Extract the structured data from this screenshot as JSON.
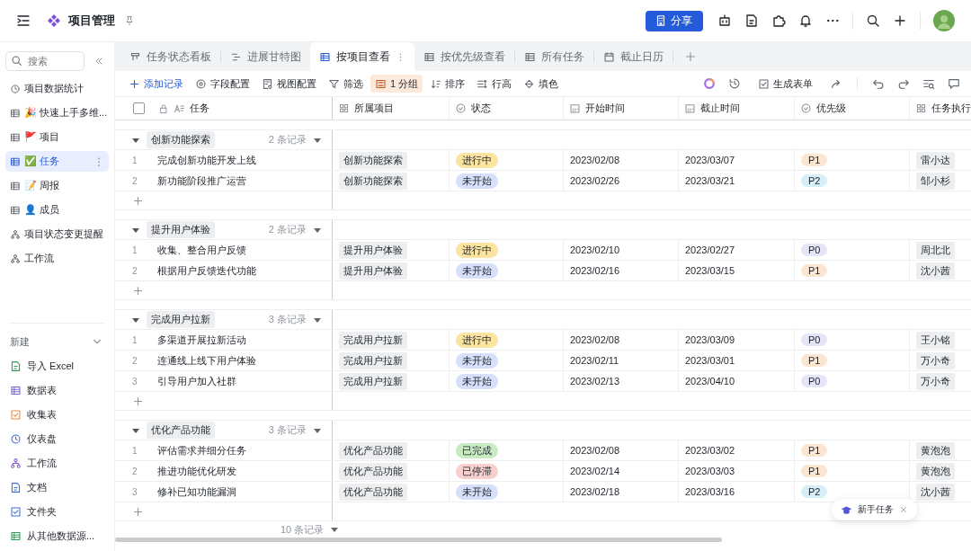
{
  "header": {
    "title": "项目管理",
    "share_button": "分享"
  },
  "sidebar": {
    "search": {
      "placeholder": "搜索"
    },
    "items": [
      {
        "label": "项目数据统计",
        "kind": "dashboard",
        "selected": false
      },
      {
        "label": "🎉 快速上手多维...",
        "kind": "table",
        "selected": false
      },
      {
        "label": "🚩 项目",
        "kind": "table",
        "selected": false
      },
      {
        "label": "✅ 任务",
        "kind": "table",
        "selected": true
      },
      {
        "label": "📝 周报",
        "kind": "table",
        "selected": false
      },
      {
        "label": "👤 成员",
        "kind": "table",
        "selected": false
      },
      {
        "label": "项目状态变更提醒",
        "kind": "workflow",
        "selected": false
      },
      {
        "label": "工作流",
        "kind": "workflow",
        "selected": false
      }
    ],
    "new_section": {
      "label": "新建",
      "items": [
        {
          "label": "导入 Excel",
          "kind": "excel"
        },
        {
          "label": "数据表",
          "kind": "datatable"
        },
        {
          "label": "收集表",
          "kind": "form"
        },
        {
          "label": "仪表盘",
          "kind": "dashboard"
        },
        {
          "label": "工作流",
          "kind": "workflow"
        },
        {
          "label": "文档",
          "kind": "doc"
        },
        {
          "label": "文件夹",
          "kind": "folder"
        },
        {
          "label": "从其他数据源...",
          "kind": "source"
        }
      ]
    }
  },
  "tabs": [
    {
      "label": "任务状态看板",
      "kind": "kanban",
      "selected": false
    },
    {
      "label": "进展甘特图",
      "kind": "gantt",
      "selected": false
    },
    {
      "label": "按项目查看",
      "kind": "grid",
      "selected": true
    },
    {
      "label": "按优先级查看",
      "kind": "grid",
      "selected": false
    },
    {
      "label": "所有任务",
      "kind": "grid",
      "selected": false
    },
    {
      "label": "截止日历",
      "kind": "calendar",
      "selected": false
    }
  ],
  "toolbar": {
    "left": [
      {
        "label": "添加记录",
        "kind": "add",
        "active": false
      },
      {
        "label": "字段配置",
        "kind": "gear",
        "active": false
      },
      {
        "label": "视图配置",
        "kind": "view",
        "active": false
      },
      {
        "label": "筛选",
        "kind": "filter",
        "active": false
      },
      {
        "label": "1 分组",
        "kind": "group",
        "active": true
      },
      {
        "label": "排序",
        "kind": "sort",
        "active": false
      },
      {
        "label": "行高",
        "kind": "rowheight",
        "active": false
      },
      {
        "label": "填色",
        "kind": "fill",
        "active": false
      }
    ],
    "right": [
      {
        "kind": "ai"
      },
      {
        "kind": "history"
      },
      {
        "kind": "form",
        "label": "生成表单"
      },
      {
        "kind": "shareout"
      },
      {
        "kind": "undo"
      },
      {
        "kind": "redo"
      },
      {
        "kind": "findlist"
      },
      {
        "kind": "comment"
      }
    ]
  },
  "table": {
    "select_all": {
      "checked": false
    },
    "columns": [
      {
        "label": "任务",
        "kind": "text"
      },
      {
        "label": "所属项目",
        "kind": "link"
      },
      {
        "label": "状态",
        "kind": "status"
      },
      {
        "label": "开始时间",
        "kind": "date"
      },
      {
        "label": "截止时间",
        "kind": "date"
      },
      {
        "label": "优先级",
        "kind": "status"
      },
      {
        "label": "任务执行",
        "kind": "link"
      }
    ],
    "groups": [
      {
        "name": "创新功能探索",
        "count": "2 条记录",
        "rows": [
          {
            "index": "1",
            "task": "完成创新功能开发上线",
            "project": "创新功能探索",
            "status": {
              "text": "进行中",
              "color": "#fbe3a0"
            },
            "start": "2023/02/08",
            "end": "2023/03/07",
            "priority": {
              "text": "P1",
              "color": "#fbe6d2"
            },
            "assignee": "雷小达"
          },
          {
            "index": "2",
            "task": "新功能阶段推广运营",
            "project": "创新功能探索",
            "status": {
              "text": "未开始",
              "color": "#d7e0fa"
            },
            "start": "2023/02/26",
            "end": "2023/03/21",
            "priority": {
              "text": "P2",
              "color": "#d6eff8"
            },
            "assignee": "邹小杉"
          }
        ]
      },
      {
        "name": "提升用户体验",
        "count": "2 条记录",
        "rows": [
          {
            "index": "1",
            "task": "收集、整合用户反馈",
            "project": "提升用户体验",
            "status": {
              "text": "进行中",
              "color": "#fbe3a0"
            },
            "start": "2023/02/10",
            "end": "2023/02/27",
            "priority": {
              "text": "P0",
              "color": "#e4e6f8"
            },
            "assignee": "周北北"
          },
          {
            "index": "2",
            "task": "根据用户反馈迭代功能",
            "project": "提升用户体验",
            "status": {
              "text": "未开始",
              "color": "#d7e0fa"
            },
            "start": "2023/02/16",
            "end": "2023/03/15",
            "priority": {
              "text": "P1",
              "color": "#fbe6d2"
            },
            "assignee": "沈小茜"
          }
        ]
      },
      {
        "name": "完成用户拉新",
        "count": "3 条记录",
        "rows": [
          {
            "index": "1",
            "task": "多渠道开展拉新活动",
            "project": "完成用户拉新",
            "status": {
              "text": "进行中",
              "color": "#fbe3a0"
            },
            "start": "2023/02/08",
            "end": "2023/03/09",
            "priority": {
              "text": "P0",
              "color": "#e4e6f8"
            },
            "assignee": "王小铭"
          },
          {
            "index": "2",
            "task": "连通线上线下用户体验",
            "project": "完成用户拉新",
            "status": {
              "text": "未开始",
              "color": "#d7e0fa"
            },
            "start": "2023/02/11",
            "end": "2023/03/01",
            "priority": {
              "text": "P1",
              "color": "#fbe6d2"
            },
            "assignee": "万小奇"
          },
          {
            "index": "3",
            "task": "引导用户加入社群",
            "project": "完成用户拉新",
            "status": {
              "text": "未开始",
              "color": "#d7e0fa"
            },
            "start": "2023/02/13",
            "end": "2023/04/10",
            "priority": {
              "text": "P0",
              "color": "#e4e6f8"
            },
            "assignee": "万小奇"
          }
        ]
      },
      {
        "name": "优化产品功能",
        "count": "3 条记录",
        "rows": [
          {
            "index": "1",
            "task": "评估需求并细分任务",
            "project": "优化产品功能",
            "status": {
              "text": "已完成",
              "color": "#c8ebc4"
            },
            "start": "2023/02/08",
            "end": "2023/03/02",
            "priority": {
              "text": "P1",
              "color": "#fbe6d2"
            },
            "assignee": "黄泡泡"
          },
          {
            "index": "2",
            "task": "推进功能优化研发",
            "project": "优化产品功能",
            "status": {
              "text": "已停滞",
              "color": "#f8cfcf"
            },
            "start": "2023/02/14",
            "end": "2023/03/03",
            "priority": {
              "text": "P1",
              "color": "#fbe6d2"
            },
            "assignee": "黄泡泡"
          },
          {
            "index": "3",
            "task": "修补已知功能漏洞",
            "project": "优化产品功能",
            "status": {
              "text": "未开始",
              "color": "#d7e0fa"
            },
            "start": "2023/02/18",
            "end": "2023/03/16",
            "priority": {
              "text": "P2",
              "color": "#d6eff8"
            },
            "assignee": "沈小茜"
          }
        ]
      }
    ],
    "footer": "10 条记录"
  },
  "guide_chip": {
    "label": "新手任务"
  }
}
